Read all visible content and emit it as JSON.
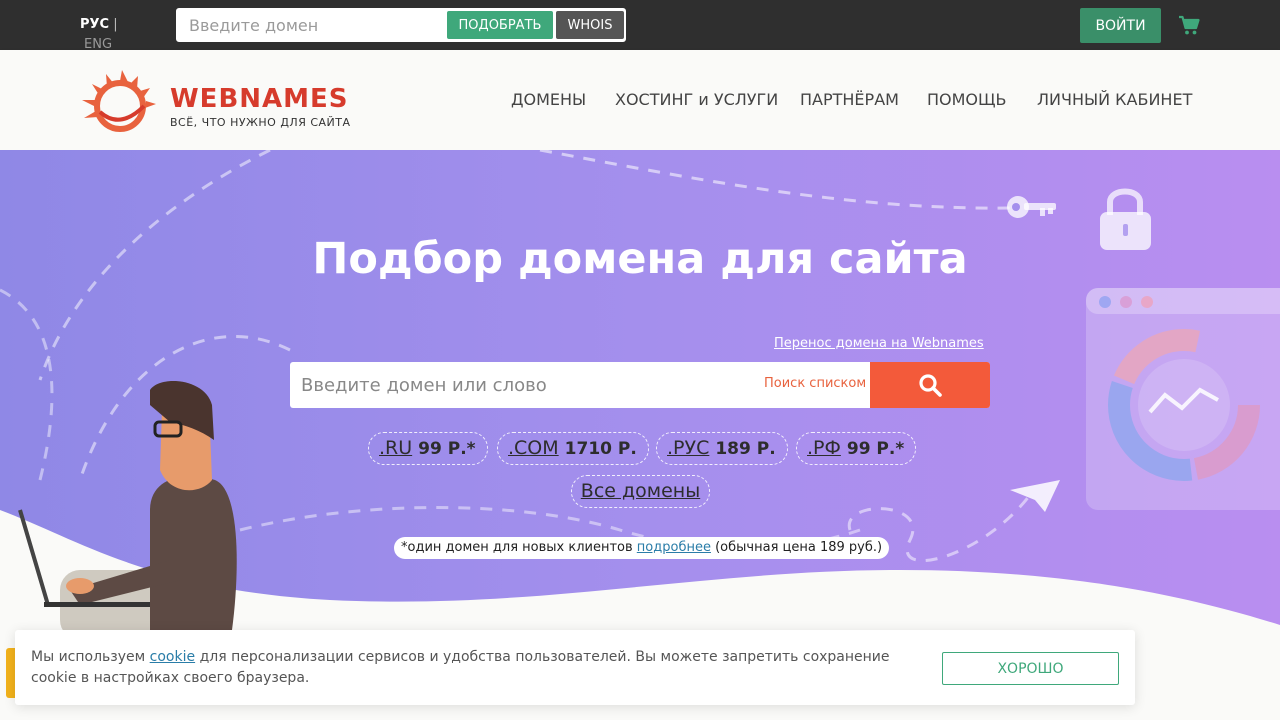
{
  "topbar": {
    "lang_current": "РУС",
    "lang_sep": "|",
    "lang_other": "ENG",
    "search_placeholder": "Введите домен",
    "pick_label": "ПОДОБРАТЬ",
    "whois_label": "WHOIS",
    "login_label": "ВОЙТИ",
    "cart_icon": "cart-icon"
  },
  "header": {
    "logo_name": "WEBNAMES",
    "logo_tagline": "ВСЁ, ЧТО НУЖНО ДЛЯ САЙТА",
    "nav": [
      "ДОМЕНЫ",
      "ХОСТИНГ и УСЛУГИ",
      "ПАРТНЁРАМ",
      "ПОМОЩЬ",
      "ЛИЧНЫЙ КАБИНЕТ"
    ]
  },
  "hero": {
    "title": "Подбор домена для сайта",
    "transfer_link": "Перенос домена на Webnames",
    "search_placeholder": "Введите домен или слово",
    "list_search": "Поиск списком",
    "search_icon": "search-icon",
    "zones": [
      {
        "name": ".RU",
        "price": "99 Р.*"
      },
      {
        "name": ".COM",
        "price": "1710 Р."
      },
      {
        "name": ".РУС",
        "price": "189 Р."
      },
      {
        "name": ".РФ",
        "price": "99 Р.*"
      }
    ],
    "all_zones": "Все домены",
    "note_prefix": "*один домен для новых клиентов",
    "note_link": "подробнее",
    "note_suffix": "(обычная цена 189 руб.)"
  },
  "cookie": {
    "text_before": "Мы используем",
    "link": "cookie",
    "text_after": "для персонализации сервисов и удобства пользователей. Вы можете запретить сохранение cookie в настройках своего браузера.",
    "ok_label": "ХОРОШО"
  },
  "colors": {
    "topbar_bg": "#2f2f2f",
    "green": "#3fa87b",
    "brand_red": "#d63b2c",
    "search_orange": "#f35a3a",
    "hero_purple": "#a48fed"
  }
}
